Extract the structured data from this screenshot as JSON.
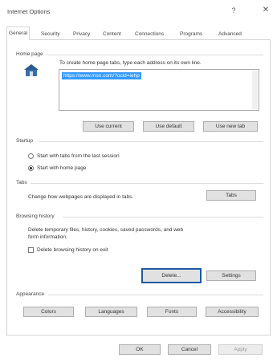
{
  "window": {
    "title": "Internet Options",
    "help_glyph": "?",
    "close_glyph": "✕"
  },
  "tabs": [
    {
      "label": "General"
    },
    {
      "label": "Security"
    },
    {
      "label": "Privacy"
    },
    {
      "label": "Content"
    },
    {
      "label": "Connections"
    },
    {
      "label": "Programs"
    },
    {
      "label": "Advanced"
    }
  ],
  "home_page": {
    "group_label": "Home page",
    "description": "To create home page tabs, type each address on its own line.",
    "url": "https://www.msn.com/?ocid=iehp",
    "use_current_label": "Use current",
    "use_default_label": "Use default",
    "use_new_tab_label": "Use new tab",
    "icon": "home-page-icon"
  },
  "startup": {
    "group_label": "Startup",
    "option_tabs_label": "Start with tabs from the last session",
    "option_home_label": "Start with home page",
    "selected": "home"
  },
  "tabs_section": {
    "group_label": "Tabs",
    "description": "Change how webpages are displayed in tabs.",
    "button_label": "Tabs"
  },
  "browsing_history": {
    "group_label": "Browsing history",
    "description_line1": "Delete temporary files, history, cookies, saved passwords, and web",
    "description_line2": "form information.",
    "checkbox_label": "Delete browsing history on exit",
    "checked": false,
    "delete_label": "Delete...",
    "settings_label": "Settings"
  },
  "appearance": {
    "group_label": "Appearance",
    "colors_label": "Colors",
    "languages_label": "Languages",
    "fonts_label": "Fonts",
    "accessibility_label": "Accessibility"
  },
  "footer": {
    "ok_label": "OK",
    "cancel_label": "Cancel",
    "apply_label": "Apply"
  },
  "colors": {
    "focus_outline": "#1d5aa0",
    "selection": "#3399ff"
  }
}
